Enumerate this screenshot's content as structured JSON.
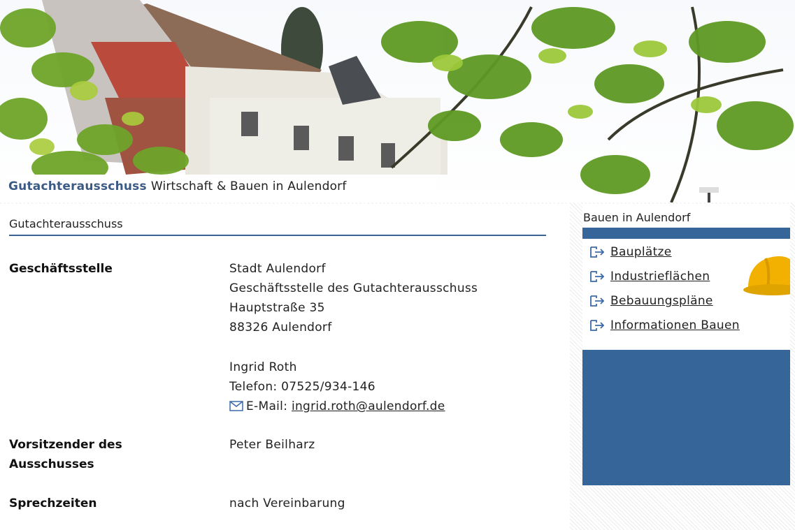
{
  "header": {
    "title_highlight": "Gutachterausschuss",
    "title_rest": "Wirtschaft & Bauen in Aulendorf"
  },
  "main": {
    "page_title": "Gutachterausschuss",
    "rows": [
      {
        "label": "Geschäftsstelle",
        "lines": [
          "Stadt Aulendorf",
          "Geschäftsstelle des Gutachterausschuss",
          "Hauptstraße 35",
          "88326 Aulendorf"
        ],
        "contact_name": "Ingrid Roth",
        "phone": "Telefon: 07525/934-146",
        "email_label": "E-Mail:",
        "email": "ingrid.roth@aulendorf.de"
      },
      {
        "label_line1": "Vorsitzender des",
        "label_line2": "Ausschusses",
        "value": "Peter Beilharz"
      },
      {
        "label": "Sprechzeiten",
        "value": "nach Vereinbarung"
      }
    ]
  },
  "sidebar": {
    "heading": "Bauen in Aulendorf",
    "links": [
      "Bauplätze",
      "Industrieflächen",
      "Bebauungspläne",
      "Informationen Bauen"
    ]
  },
  "colors": {
    "accent": "#356599",
    "header_highlight": "#3b5b86",
    "rule": "#3a6293"
  },
  "icons": {
    "mail": "envelope-icon",
    "link": "link-arrow-icon",
    "decor": "hard-hat-icon"
  }
}
